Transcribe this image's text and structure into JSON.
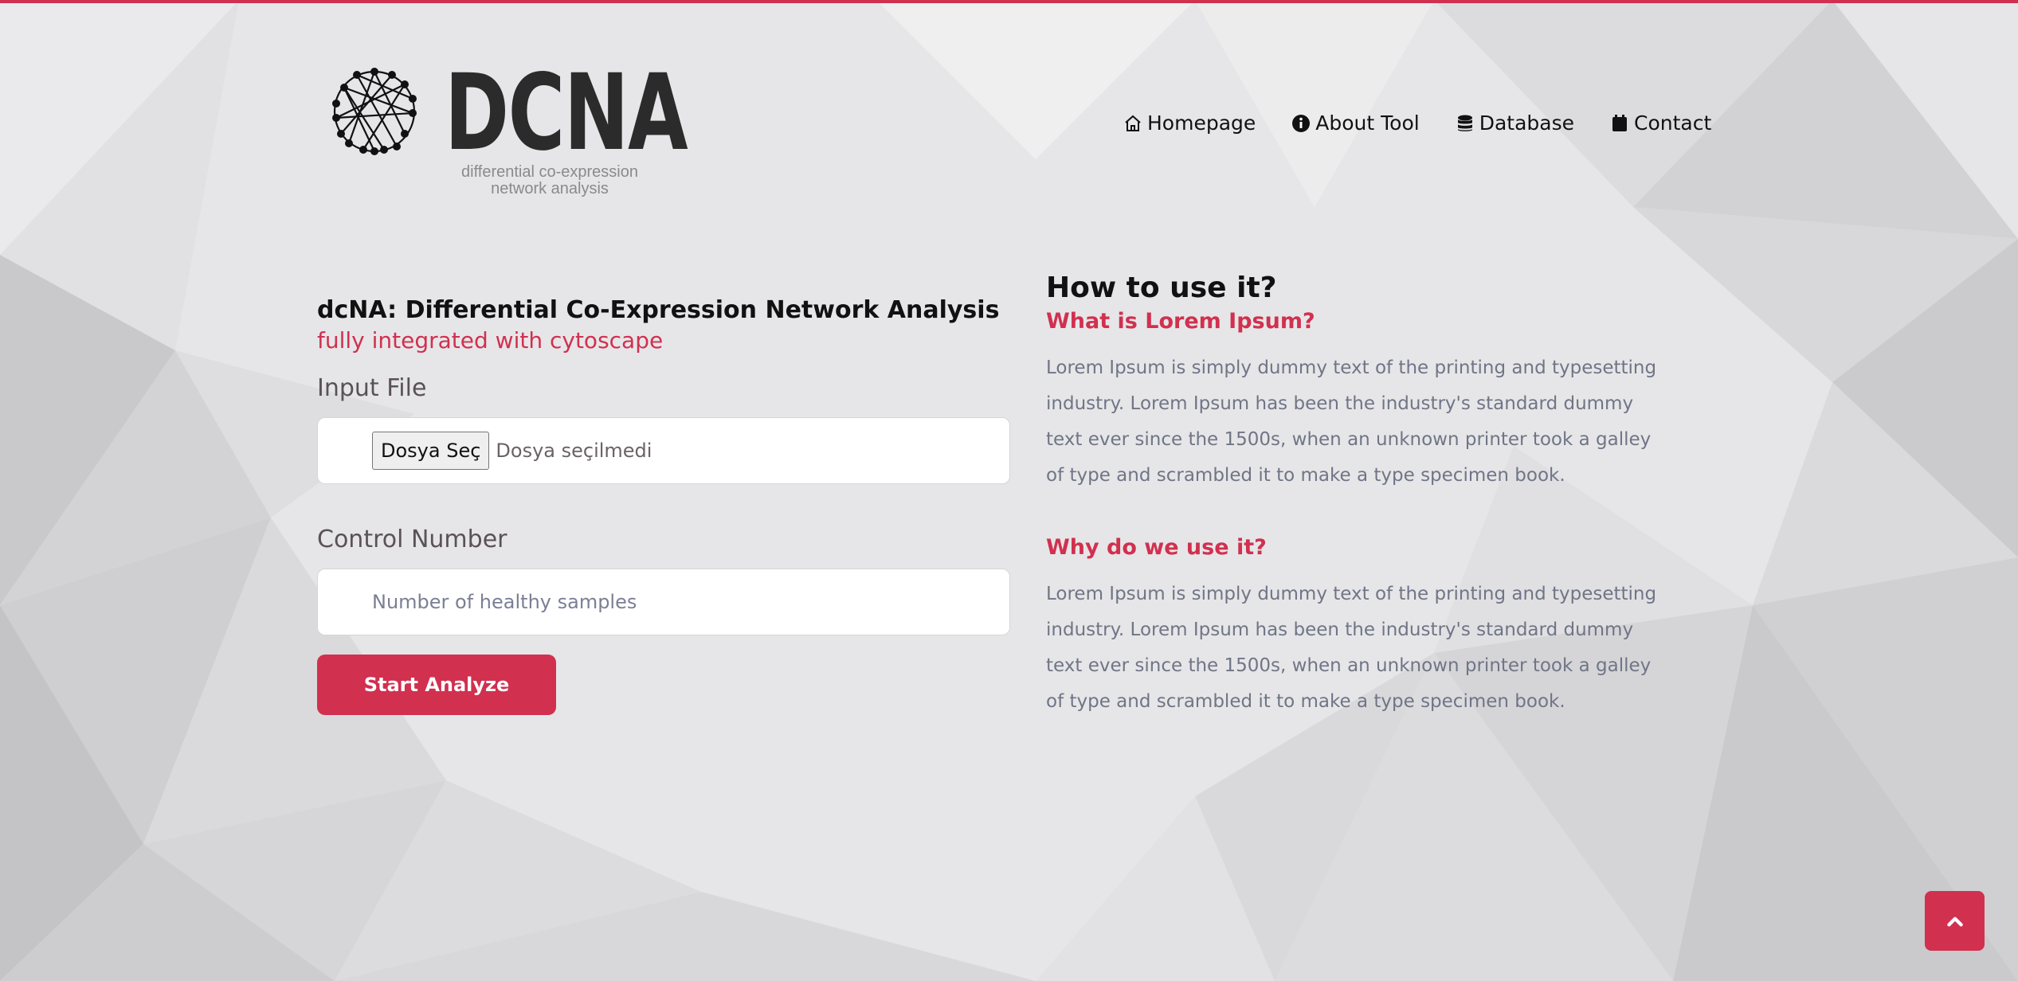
{
  "brand": {
    "wordmark": "DCNA",
    "tagline_line1": "differential co-expression",
    "tagline_line2": "network analysis",
    "accent_color": "#d1304f"
  },
  "nav": {
    "items": [
      {
        "label": "Homepage",
        "icon": "home-icon"
      },
      {
        "label": "About Tool",
        "icon": "info-circle-icon"
      },
      {
        "label": "Database",
        "icon": "database-icon"
      },
      {
        "label": "Contact",
        "icon": "calendar-icon"
      }
    ]
  },
  "form": {
    "title": "dcNA: Differential Co-Expression Network Analysis",
    "subtitle": "fully integrated with cytoscape",
    "input_file_label": "Input File",
    "file_button": "Dosya Seç",
    "file_status": "Dosya seçilmedi",
    "control_label": "Control Number",
    "control_placeholder": "Number of healthy samples",
    "submit": "Start Analyze"
  },
  "help": {
    "heading": "How to use it?",
    "q1": "What is Lorem Ipsum?",
    "p1": "Lorem Ipsum is simply dummy text of the printing and typesetting industry. Lorem Ipsum has been the industry's standard dummy text ever since the 1500s, when an unknown printer took a galley of type and scrambled it to make a type specimen book.",
    "q2": "Why do we use it?",
    "p2": "Lorem Ipsum is simply dummy text of the printing and typesetting industry. Lorem Ipsum has been the industry's standard dummy text ever since the 1500s, when an unknown printer took a galley of type and scrambled it to make a type specimen book."
  },
  "scroll_top": {
    "icon": "chevron-up-icon"
  }
}
